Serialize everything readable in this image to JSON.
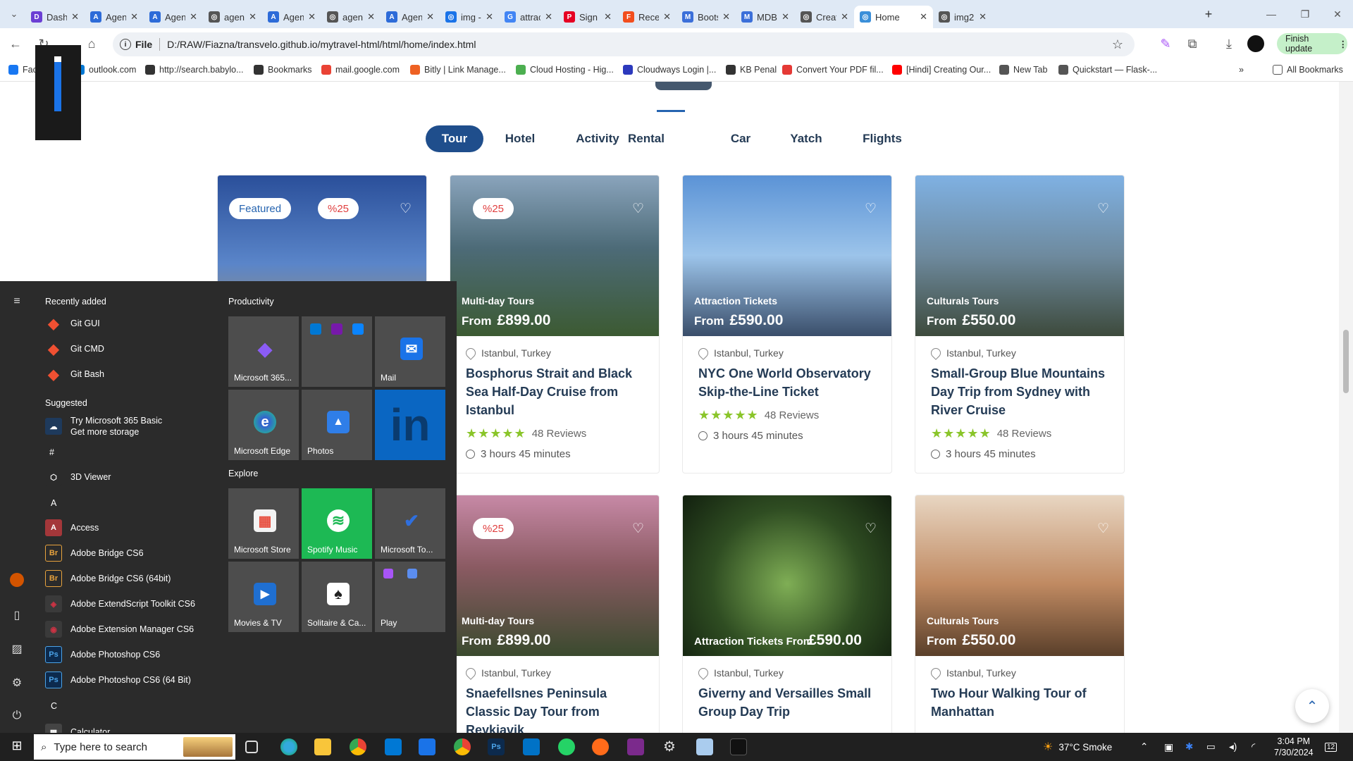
{
  "browser": {
    "tabs": [
      {
        "title": "Dashb",
        "color": "#6b3fd4",
        "glyph": "D"
      },
      {
        "title": "Agent",
        "color": "#2d6bd8",
        "glyph": "A"
      },
      {
        "title": "Agent",
        "color": "#2d6bd8",
        "glyph": "A"
      },
      {
        "title": "agent",
        "color": "#555555",
        "glyph": "◎"
      },
      {
        "title": "Agent",
        "color": "#2d6bd8",
        "glyph": "A"
      },
      {
        "title": "agent",
        "color": "#555555",
        "glyph": "◎"
      },
      {
        "title": "Agent",
        "color": "#2d6bd8",
        "glyph": "A"
      },
      {
        "title": "img -",
        "color": "#1a73e8",
        "glyph": "◎"
      },
      {
        "title": "attrac",
        "color": "#4285f4",
        "glyph": "G"
      },
      {
        "title": "Sign I",
        "color": "#e60023",
        "glyph": "P"
      },
      {
        "title": "Recen",
        "color": "#f24e1e",
        "glyph": "F"
      },
      {
        "title": "Boots",
        "color": "#3b6fd9",
        "glyph": "M"
      },
      {
        "title": "MDBc",
        "color": "#3b6fd9",
        "glyph": "M"
      },
      {
        "title": "Creati",
        "color": "#555555",
        "glyph": "◎"
      },
      {
        "title": "Home",
        "color": "#3b8fd9",
        "glyph": "◎",
        "active": true
      },
      {
        "title": "img2.",
        "color": "#555555",
        "glyph": "◎"
      }
    ],
    "new_tab": "+",
    "window_controls": {
      "minimize": "—",
      "maximize": "❐",
      "close": "✕"
    },
    "url_scheme": "File",
    "url": "D:/RAW/Fiazna/transvelo.github.io/mytravel-html/html/home/index.html",
    "finish_update": "Finish update",
    "bookmarks": [
      {
        "label": "Face",
        "color": "#1877f2"
      },
      {
        "label": "outlook.com",
        "color": "#0078d4"
      },
      {
        "label": "http://search.babylo...",
        "color": "#333333"
      },
      {
        "label": "Bookmarks",
        "color": "#333333"
      },
      {
        "label": "mail.google.com",
        "color": "#ea4335"
      },
      {
        "label": "Bitly | Link Manage...",
        "color": "#ee6123"
      },
      {
        "label": "Cloud Hosting - Hig...",
        "color": "#4caf50"
      },
      {
        "label": "Cloudways Login |...",
        "color": "#2c39bd"
      },
      {
        "label": "KB Penal",
        "color": "#333333"
      },
      {
        "label": "Convert Your PDF fil...",
        "color": "#e53935"
      },
      {
        "label": "[Hindi] Creating Our...",
        "color": "#ff0000"
      },
      {
        "label": "New Tab",
        "color": "#555555"
      },
      {
        "label": "Quickstart — Flask-...",
        "color": "#555555"
      }
    ],
    "all_bookmarks": "All Bookmarks"
  },
  "page": {
    "category_tabs": [
      "Tour",
      "Hotel",
      "Activity",
      "Rental",
      "Car",
      "Yatch",
      "Flights"
    ],
    "active_tab": "Tour",
    "cards": [
      {
        "featured": "Featured",
        "discount": "%25",
        "category": "",
        "price_prefix": "",
        "price": "",
        "location": "",
        "title": "",
        "reviews": "",
        "duration": "",
        "img": "stone"
      },
      {
        "featured": "",
        "discount": "%25",
        "category": "Multi-day Tours",
        "price_prefix": "From",
        "price": "£899.00",
        "location": "Istanbul, Turkey",
        "title": "Bosphorus Strait and Black Sea Half-Day Cruise from Istanbul",
        "reviews": "48 Reviews",
        "duration": "3 hours 45 minutes",
        "img": "bridge"
      },
      {
        "featured": "",
        "discount": "",
        "category": "Attraction Tickets",
        "price_prefix": "From",
        "price": "£590.00",
        "location": "Istanbul, Turkey",
        "title": "NYC One World Observatory Skip-the-Line Ticket",
        "reviews": "48 Reviews",
        "duration": "3 hours 45 minutes",
        "img": "tower"
      },
      {
        "featured": "",
        "discount": "",
        "category": "Culturals Tours",
        "price_prefix": "From",
        "price": "£550.00",
        "location": "Istanbul, Turkey",
        "title": "Small-Group Blue Mountains Day Trip from Sydney with River Cruise",
        "reviews": "48 Reviews",
        "duration": "3 hours 45 minutes",
        "img": "selfie"
      },
      {
        "featured": "",
        "discount": "%25",
        "category": "Multi-day Tours",
        "price_prefix": "From",
        "price": "£899.00",
        "location": "Istanbul, Turkey",
        "title": "Snaefellsnes Peninsula Classic Day Tour from Reykjavik",
        "reviews": "",
        "duration": "",
        "img": "mountain"
      },
      {
        "featured": "",
        "discount": "",
        "category": "Attraction Tickets From",
        "price_prefix": "",
        "price": "£590.00",
        "location": "Istanbul, Turkey",
        "title": "Giverny and Versailles Small Group Day Trip",
        "reviews": "",
        "duration": "",
        "img": "cave"
      },
      {
        "featured": "",
        "discount": "",
        "category": "Culturals Tours",
        "price_prefix": "From",
        "price": "£550.00",
        "location": "Istanbul, Turkey",
        "title": "Two Hour Walking Tour of Manhattan",
        "reviews": "",
        "duration": "",
        "img": "woman"
      }
    ],
    "stars": "★★★★★"
  },
  "start_menu": {
    "recently_added": "Recently added",
    "recent": [
      {
        "label": "Git GUI",
        "color": "#f05032",
        "glyph": "◆"
      },
      {
        "label": "Git CMD",
        "color": "#f05032",
        "glyph": "◆"
      },
      {
        "label": "Git Bash",
        "color": "#f05032",
        "glyph": "◆"
      }
    ],
    "suggested": "Suggested",
    "suggest_line1": "Try Microsoft 365 Basic",
    "suggest_line2": "Get more storage",
    "hash": "#",
    "letter_a": "A",
    "letter_c": "C",
    "apps": [
      {
        "label": "3D Viewer",
        "color": "#2b2b2b",
        "glyph": "⬡",
        "fg": "#ffffff"
      },
      {
        "label": "Access",
        "color": "#a4373a",
        "glyph": "A",
        "fg": "#ffffff"
      },
      {
        "label": "Adobe Bridge CS6",
        "color": "#2b2b2b",
        "glyph": "Br",
        "fg": "#e8a33d"
      },
      {
        "label": "Adobe Bridge CS6 (64bit)",
        "color": "#2b2b2b",
        "glyph": "Br",
        "fg": "#e8a33d"
      },
      {
        "label": "Adobe ExtendScript Toolkit CS6",
        "color": "#3a3a3a",
        "glyph": "◈",
        "fg": "#cc3344"
      },
      {
        "label": "Adobe Extension Manager CS6",
        "color": "#3a3a3a",
        "glyph": "◉",
        "fg": "#cc3344"
      },
      {
        "label": "Adobe Photoshop CS6",
        "color": "#0c2a4d",
        "glyph": "Ps",
        "fg": "#4ba3e8"
      },
      {
        "label": "Adobe Photoshop CS6 (64 Bit)",
        "color": "#0c2a4d",
        "glyph": "Ps",
        "fg": "#4ba3e8"
      }
    ],
    "calculator": "Calculator",
    "productivity": "Productivity",
    "explore": "Explore",
    "tiles": [
      {
        "label": "Microsoft 365...",
        "bg": "#4d4d4d",
        "glyph": "◆",
        "fg": "#8b5cf6"
      },
      {
        "label": "",
        "bg": "#4d4d4d",
        "glyph": "",
        "fg": "#ffffff"
      },
      {
        "label": "Mail",
        "bg": "#4d4d4d",
        "glyph": "✉",
        "fg": "#ffffff"
      },
      {
        "label": "Microsoft Edge",
        "bg": "#4d4d4d",
        "glyph": "e",
        "fg": "#ffffff"
      },
      {
        "label": "Photos",
        "bg": "#4d4d4d",
        "glyph": "▲",
        "fg": "#ffffff"
      },
      {
        "label": "",
        "bg": "#0a66c2",
        "glyph": "in",
        "fg": "#ffffff"
      },
      {
        "label": "Microsoft Store",
        "bg": "#4d4d4d",
        "glyph": "▦",
        "fg": "#ffffff"
      },
      {
        "label": "Spotify Music",
        "bg": "#1db954",
        "glyph": "≋",
        "fg": "#1db954"
      },
      {
        "label": "Microsoft To...",
        "bg": "#4d4d4d",
        "glyph": "✔",
        "fg": "#2f6fde"
      },
      {
        "label": "Movies & TV",
        "bg": "#4d4d4d",
        "glyph": "▶",
        "fg": "#ffffff"
      },
      {
        "label": "Solitaire & Ca...",
        "bg": "#4d4d4d",
        "glyph": "♠",
        "fg": "#222222"
      },
      {
        "label": "Play",
        "bg": "#4d4d4d",
        "glyph": "",
        "fg": "#ffffff"
      }
    ]
  },
  "taskbar": {
    "search_placeholder": "Type here to search",
    "weather": "37°C  Smoke",
    "time": "3:04 PM",
    "date": "7/30/2024",
    "notification_count": "12"
  }
}
